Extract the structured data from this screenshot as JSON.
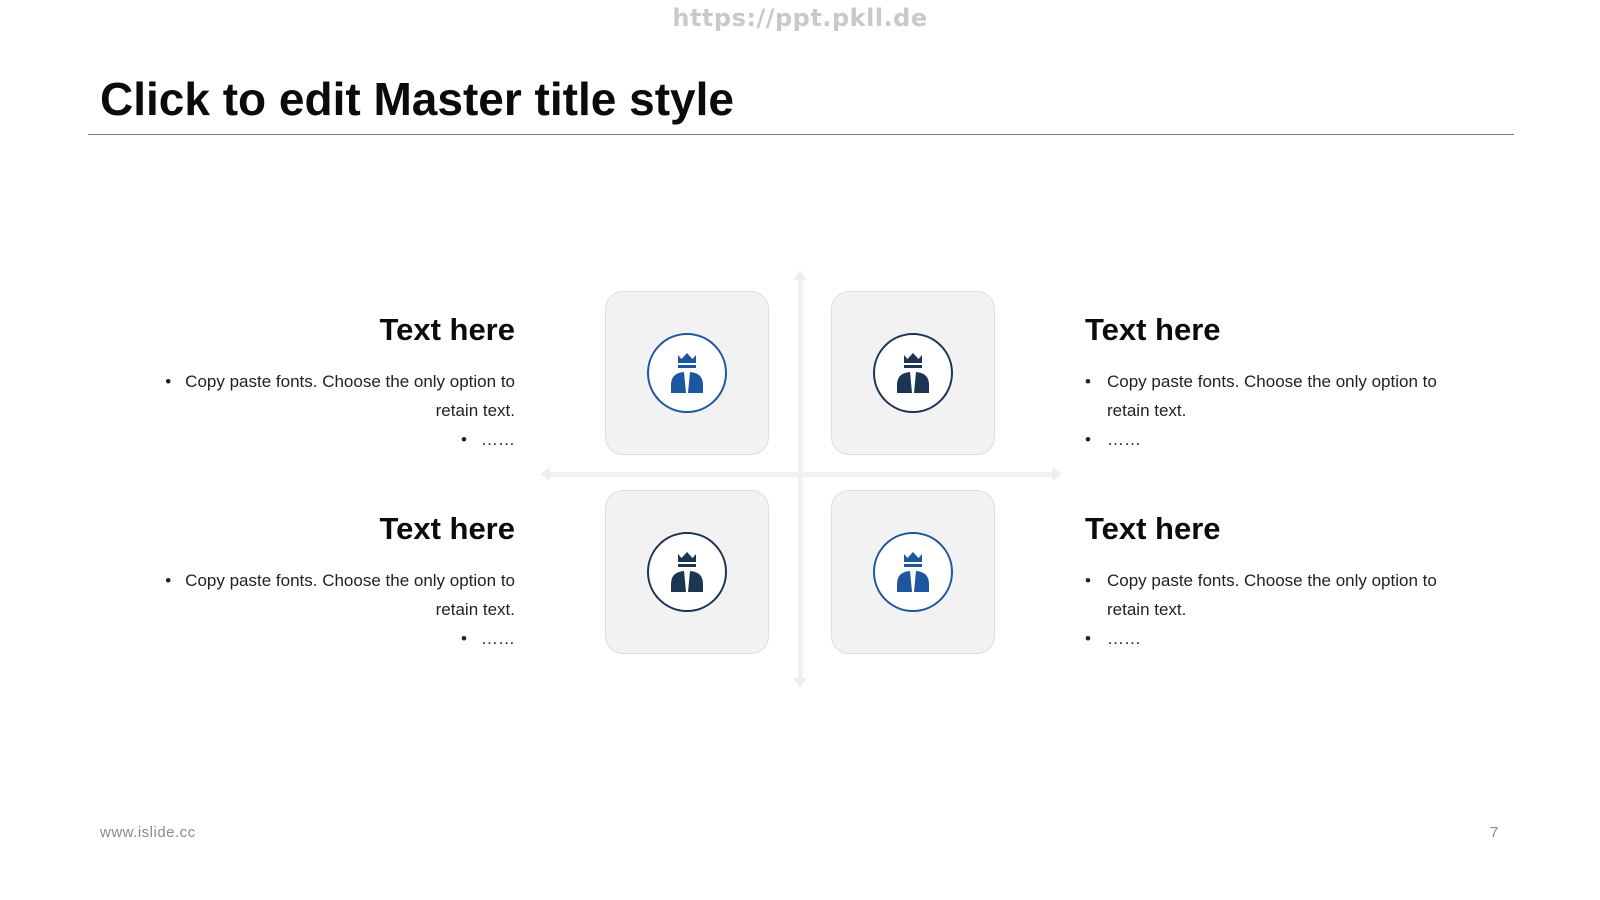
{
  "watermark": "https://ppt.pkll.de",
  "slide": {
    "title": "Click to edit Master title style",
    "footer_url": "www.islide.cc",
    "page_number": "7"
  },
  "quadrants": [
    {
      "heading": "Text here",
      "bullet_1": "Copy paste fonts. Choose the only option to retain text.",
      "bullet_2": "……",
      "icon": "leader-crown-icon",
      "icon_color": "#1f56a0"
    },
    {
      "heading": "Text here",
      "bullet_1": "Copy paste fonts. Choose the only option to retain text.",
      "bullet_2": "……",
      "icon": "leader-crown-icon",
      "icon_color": "#1d3453"
    },
    {
      "heading": "Text here",
      "bullet_1": "Copy paste fonts. Choose the only option to retain text.",
      "bullet_2": "……",
      "icon": "leader-crown-icon",
      "icon_color": "#1d3453"
    },
    {
      "heading": "Text here",
      "bullet_1": "Copy paste fonts. Choose the only option to retain text.",
      "bullet_2": "……",
      "icon": "leader-crown-icon",
      "icon_color": "#1f56a0"
    }
  ],
  "bullet_symbol": "•",
  "colors": {
    "accent_blue": "#1f56a0",
    "dark_navy": "#1d3453",
    "tile_bg": "#f2f2f2"
  }
}
